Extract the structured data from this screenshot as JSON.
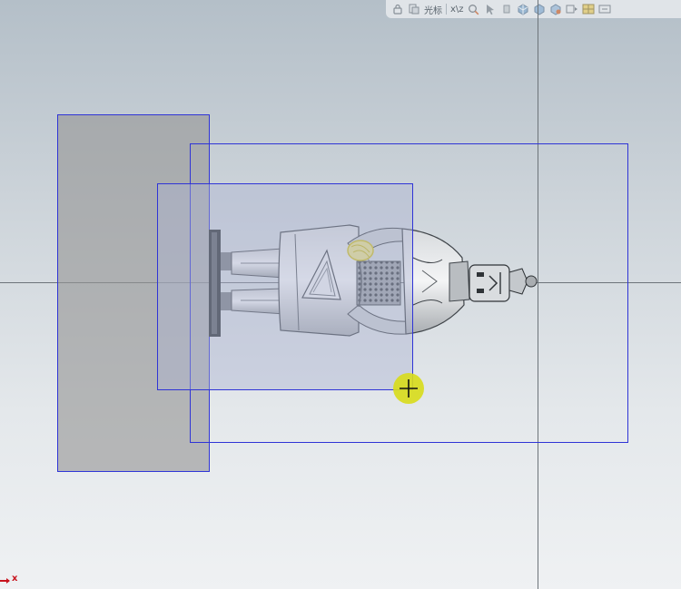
{
  "toolbar": {
    "items": [
      {
        "name": "lock-icon"
      },
      {
        "name": "view-orientation-icon"
      },
      {
        "name": "section-view-label",
        "label": "光标"
      },
      {
        "name": "coordinate-label",
        "label": "x\\z"
      },
      {
        "name": "zoom-to-area-icon"
      },
      {
        "name": "select-icon"
      },
      {
        "name": "rotate-icon"
      },
      {
        "name": "display-style-icon"
      },
      {
        "name": "shaded-icon"
      },
      {
        "name": "hide-show-icon"
      },
      {
        "name": "edit-appearance-icon"
      },
      {
        "name": "scene-icon"
      },
      {
        "name": "view-settings-icon"
      }
    ]
  },
  "triad": {
    "x_label": "x"
  },
  "colors": {
    "selection_border": "#2f34d6",
    "cursor_highlight": "#d8dc1a",
    "axis_x": "#c8141e",
    "background_top": "#b4bfc8",
    "background_bottom": "#eff1f3"
  }
}
